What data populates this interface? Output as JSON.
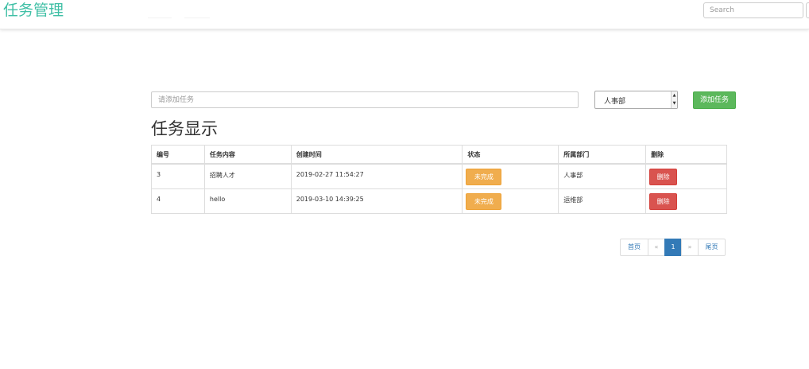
{
  "navbar": {
    "brand": "任务管理",
    "search_placeholder": "Search"
  },
  "form": {
    "task_placeholder": "请添加任务",
    "department_selected": "人事部",
    "add_button": "添加任务"
  },
  "section_title": "任务显示",
  "table": {
    "columns": [
      "编号",
      "任务内容",
      "创建时间",
      "状态",
      "所属部门",
      "删除"
    ],
    "rows": [
      {
        "id": "3",
        "content": "招聘人才",
        "created": "2019-02-27 11:54:27",
        "status": "未完成",
        "department": "人事部",
        "delete": "删除"
      },
      {
        "id": "4",
        "content": "hello",
        "created": "2019-03-10 14:39:25",
        "status": "未完成",
        "department": "运维部",
        "delete": "删除"
      }
    ]
  },
  "pagination": {
    "first": "首页",
    "prev": "«",
    "current": "1",
    "next": "»",
    "last": "尾页"
  },
  "colors": {
    "brand": "#3fbfa5",
    "add_button": "#5cb85c",
    "status_badge": "#f0ad4e",
    "delete_button": "#d9534f",
    "active_page": "#337ab7"
  }
}
